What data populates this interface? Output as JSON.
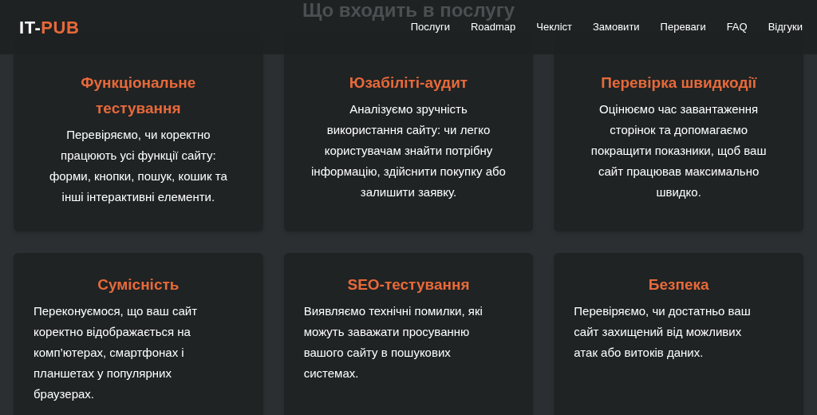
{
  "section_title": "Що входить в послугу",
  "header": {
    "logo": {
      "prefix": "IT-",
      "accent": "PUB"
    },
    "nav": [
      "Послуги",
      "Roadmap",
      "Чекліст",
      "Замовити",
      "Переваги",
      "FAQ",
      "Відгуки"
    ]
  },
  "cards": [
    {
      "title": "Функціональне тестування",
      "text": "Перевіряємо, чи коректно працюють усі функції сайту: форми, кнопки, пошук, кошик та інші інтерактивні елементи.",
      "text_centered": true
    },
    {
      "title": "Юзабіліті-аудит",
      "text": "Аналізуємо зручність використання сайту: чи легко користувачам знайти потрібну інформацію, здійснити покупку або залишити заявку.",
      "text_centered": true
    },
    {
      "title": "Перевірка швидкодії",
      "text": "Оцінюємо час завантаження сторінок та допомагаємо покращити показники, щоб ваш сайт працював максимально швидко.",
      "text_centered": true
    },
    {
      "title": "Сумісність",
      "text": "Переконуємося, що ваш сайт коректно відображається на комп’ютерах, смартфонах і планшетах у популярних браузерах.",
      "text_centered": false
    },
    {
      "title": "SEO-тестування",
      "text": "Виявляємо технічні помилки, які можуть заважати просуванню вашого сайту в пошукових системах.",
      "text_centered": false
    },
    {
      "title": "Безпека",
      "text": "Перевіряємо, чи достатньо ваш сайт захищений від можливих атак або витоків даних.",
      "text_centered": false
    }
  ]
}
